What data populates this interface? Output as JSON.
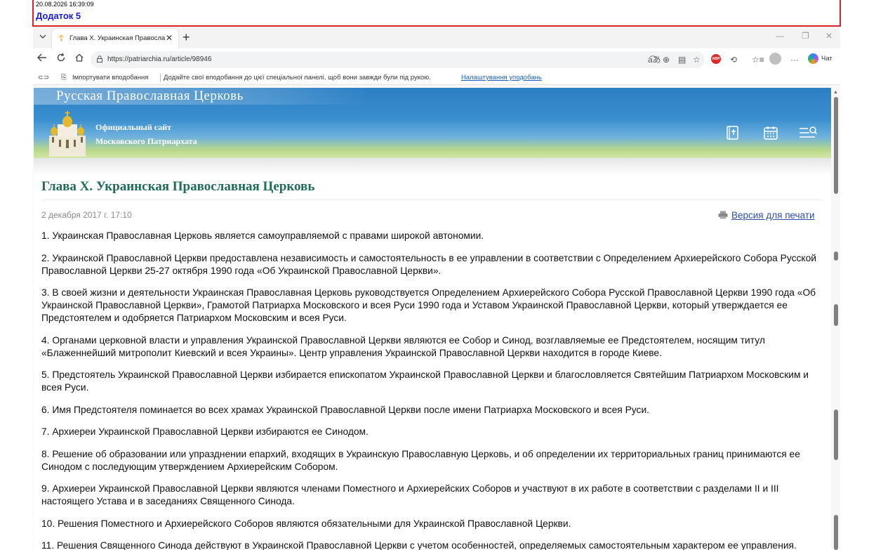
{
  "annotation": {
    "timestamp": "20.08.2026  16:39:09",
    "attachment": "Додаток 5"
  },
  "browser": {
    "tab_title": "Глава X. Украинская Православна",
    "url": "https://patriarchia.ru/article/98946",
    "chat_label": "Чат",
    "adblock_label": "ABP",
    "favorites_bar": {
      "import_label": "Імпортувати вподобання",
      "message": "Додайте свої вподобання до цієї спеціальної панелі, щоб вони завжди були під рукою.",
      "settings_link": "Налаштування уподобань"
    }
  },
  "site": {
    "banner_title": "Русская  Православная  Церковь",
    "name_line1": "Официальный сайт",
    "name_line2": "Московского Патриархата"
  },
  "article": {
    "title": "Глава X. Украинская Православная Церковь",
    "date": "2 декабря 2017 г. 17:10",
    "print_label": "Версия для печати",
    "paragraphs": [
      "1. Украинская Православная Церковь является самоуправляемой с правами широкой автономии.",
      "2. Украинской Православной Церкви предоставлена независимость и самостоятельность в ее управлении в соответствии с Определением Архиерейского Собора Русской Православной Церкви 25-27 октября 1990 года «Об Украинской Православной Церкви».",
      "3. В своей жизни и деятельности Украинская Православная Церковь руководствуется Определением Архиерейского Собора Русской Православной Церкви 1990 года «Об Украинской Православной Церкви», Грамотой Патриарха Московского и всея Руси 1990 года и Уставом Украинской Православной Церкви, который утверждается ее Предстоятелем и одобряется Патриархом Московским и всея Руси.",
      "4. Органами церковной власти и управления Украинской Православной Церкви являются ее Собор и Синод, возглавляемые ее Предстоятелем, носящим титул «Блаженнейший митрополит Киевский и всея Украины». Центр управления Украинской Православной Церкви находится в городе Киеве.",
      "5. Предстоятель Украинской Православной Церкви избирается епископатом Украинской Православной Церкви и благословляется Святейшим Патриархом Московским и всея Руси.",
      "6. Имя Предстоятеля поминается во всех храмах Украинской Православной Церкви после имени Патриарха Московского и всея Руси.",
      "7. Архиереи Украинской Православной Церкви избираются ее Синодом.",
      "8. Решение об образовании или упразднении епархий, входящих в Украинскую Православную Церковь, и об определении их территориальных границ принимаются ее Синодом с последующим утверждением Архиерейским Собором.",
      "9. Архиереи Украинской Православной Церкви являются членами Поместного и Архиерейских Соборов и участвуют в их работе в соответствии с разделами II и III настоящего Устава и в заседаниях Священного Синода.",
      "10. Решения Поместного и Архиерейского Соборов являются обязательными для Украинской Православной Церкви.",
      "11. Решения Священного Синода действуют в Украинской Православной Церкви с учетом особенностей, определяемых самостоятельным характером ее управления."
    ]
  }
}
